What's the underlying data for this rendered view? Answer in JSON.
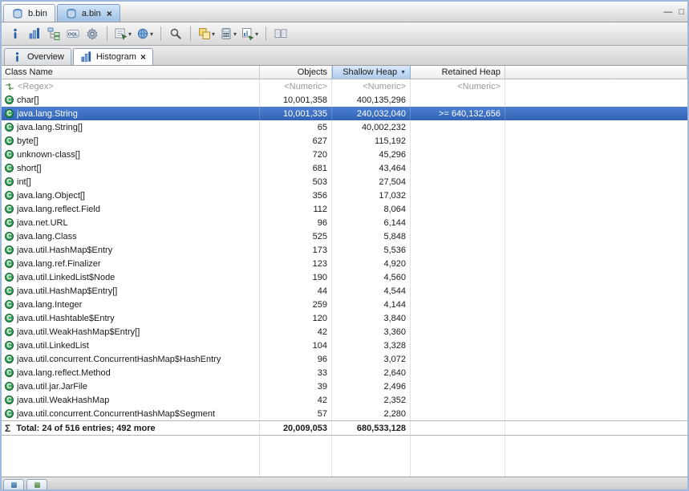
{
  "glyphs": {
    "close": "×",
    "dropdown": "▾",
    "sort_desc": "▼",
    "minimize": "—",
    "maximize": "□",
    "sigma": "Σ",
    "class_letter": "C"
  },
  "editor_tabs": [
    {
      "label": "b.bin",
      "icon": "heap-dump-icon",
      "active": false,
      "closable": false
    },
    {
      "label": "a.bin",
      "icon": "heap-dump-icon",
      "active": true,
      "closable": true
    }
  ],
  "toolbar": {
    "items": [
      {
        "name": "info-icon"
      },
      {
        "name": "histogram-icon"
      },
      {
        "name": "dominator-tree-icon"
      },
      {
        "name": "oql-icon"
      },
      {
        "name": "expert-system-icon"
      },
      {
        "separator": true
      },
      {
        "name": "query-browser-icon",
        "dropdown": true
      },
      {
        "name": "run-report-icon",
        "dropdown": true
      },
      {
        "separator": true
      },
      {
        "name": "search-icon"
      },
      {
        "separator": true
      },
      {
        "name": "group-by-icon",
        "dropdown": true
      },
      {
        "name": "calculator-icon",
        "dropdown": true
      },
      {
        "name": "export-icon",
        "dropdown": true
      },
      {
        "separator": true
      },
      {
        "name": "compare-icon"
      }
    ]
  },
  "view_tabs": [
    {
      "label": "Overview",
      "icon": "info-icon",
      "active": false,
      "closable": false
    },
    {
      "label": "Histogram",
      "icon": "histogram-icon",
      "active": true,
      "closable": true
    }
  ],
  "table": {
    "columns": [
      {
        "label": "Class Name",
        "align": "left"
      },
      {
        "label": "Objects",
        "align": "right"
      },
      {
        "label": "Shallow Heap",
        "align": "right",
        "sorted": "desc"
      },
      {
        "label": "Retained Heap",
        "align": "right"
      }
    ],
    "filter_row": {
      "class_name": "<Regex>",
      "objects": "<Numeric>",
      "shallow_heap": "<Numeric>",
      "retained_heap": "<Numeric>"
    },
    "rows": [
      {
        "class_name": "char[]",
        "objects": "10,001,358",
        "shallow_heap": "400,135,296",
        "retained_heap": ""
      },
      {
        "class_name": "java.lang.String",
        "objects": "10,001,335",
        "shallow_heap": "240,032,040",
        "retained_heap": ">= 640,132,656",
        "selected": true
      },
      {
        "class_name": "java.lang.String[]",
        "objects": "65",
        "shallow_heap": "40,002,232",
        "retained_heap": ""
      },
      {
        "class_name": "byte[]",
        "objects": "627",
        "shallow_heap": "115,192",
        "retained_heap": ""
      },
      {
        "class_name": "unknown-class[]",
        "objects": "720",
        "shallow_heap": "45,296",
        "retained_heap": ""
      },
      {
        "class_name": "short[]",
        "objects": "681",
        "shallow_heap": "43,464",
        "retained_heap": ""
      },
      {
        "class_name": "int[]",
        "objects": "503",
        "shallow_heap": "27,504",
        "retained_heap": ""
      },
      {
        "class_name": "java.lang.Object[]",
        "objects": "356",
        "shallow_heap": "17,032",
        "retained_heap": ""
      },
      {
        "class_name": "java.lang.reflect.Field",
        "objects": "112",
        "shallow_heap": "8,064",
        "retained_heap": ""
      },
      {
        "class_name": "java.net.URL",
        "objects": "96",
        "shallow_heap": "6,144",
        "retained_heap": ""
      },
      {
        "class_name": "java.lang.Class",
        "objects": "525",
        "shallow_heap": "5,848",
        "retained_heap": ""
      },
      {
        "class_name": "java.util.HashMap$Entry",
        "objects": "173",
        "shallow_heap": "5,536",
        "retained_heap": ""
      },
      {
        "class_name": "java.lang.ref.Finalizer",
        "objects": "123",
        "shallow_heap": "4,920",
        "retained_heap": ""
      },
      {
        "class_name": "java.util.LinkedList$Node",
        "objects": "190",
        "shallow_heap": "4,560",
        "retained_heap": ""
      },
      {
        "class_name": "java.util.HashMap$Entry[]",
        "objects": "44",
        "shallow_heap": "4,544",
        "retained_heap": ""
      },
      {
        "class_name": "java.lang.Integer",
        "objects": "259",
        "shallow_heap": "4,144",
        "retained_heap": ""
      },
      {
        "class_name": "java.util.Hashtable$Entry",
        "objects": "120",
        "shallow_heap": "3,840",
        "retained_heap": ""
      },
      {
        "class_name": "java.util.WeakHashMap$Entry[]",
        "objects": "42",
        "shallow_heap": "3,360",
        "retained_heap": ""
      },
      {
        "class_name": "java.util.LinkedList",
        "objects": "104",
        "shallow_heap": "3,328",
        "retained_heap": ""
      },
      {
        "class_name": "java.util.concurrent.ConcurrentHashMap$HashEntry",
        "objects": "96",
        "shallow_heap": "3,072",
        "retained_heap": ""
      },
      {
        "class_name": "java.lang.reflect.Method",
        "objects": "33",
        "shallow_heap": "2,640",
        "retained_heap": ""
      },
      {
        "class_name": "java.util.jar.JarFile",
        "objects": "39",
        "shallow_heap": "2,496",
        "retained_heap": ""
      },
      {
        "class_name": "java.util.WeakHashMap",
        "objects": "42",
        "shallow_heap": "2,352",
        "retained_heap": ""
      },
      {
        "class_name": "java.util.concurrent.ConcurrentHashMap$Segment",
        "objects": "57",
        "shallow_heap": "2,280",
        "retained_heap": ""
      }
    ],
    "total_row": {
      "label": "Total: 24 of 516 entries; 492 more",
      "objects": "20,009,053",
      "shallow_heap": "680,533,128",
      "retained_heap": ""
    }
  }
}
